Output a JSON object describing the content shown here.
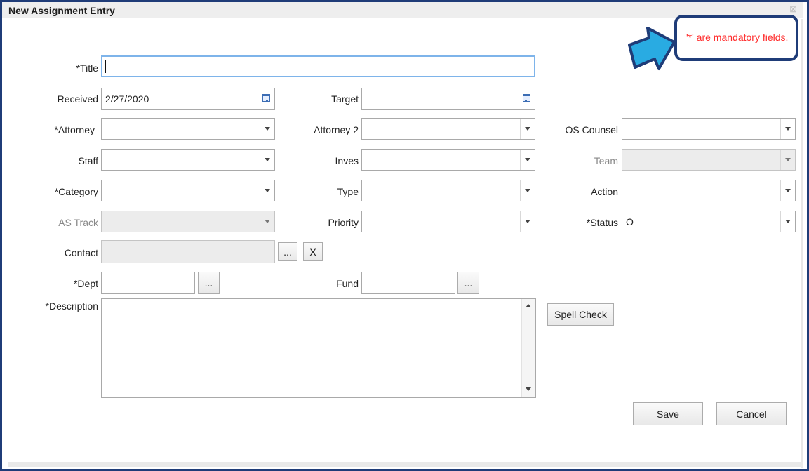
{
  "dialog": {
    "title": "New Assignment Entry",
    "close_glyph": "⊠"
  },
  "note": "'*' are mandatory fields.",
  "fields": {
    "title": {
      "label": "*Title",
      "value": ""
    },
    "received": {
      "label": "Received",
      "value": "2/27/2020"
    },
    "target": {
      "label": "Target",
      "value": ""
    },
    "attorney": {
      "label": "*Attorney",
      "value": ""
    },
    "attorney2": {
      "label": "Attorney 2",
      "value": ""
    },
    "os_counsel": {
      "label": "OS Counsel",
      "value": ""
    },
    "staff": {
      "label": "Staff",
      "value": ""
    },
    "inves": {
      "label": "Inves",
      "value": ""
    },
    "team": {
      "label": "Team",
      "value": ""
    },
    "category": {
      "label": "*Category",
      "value": ""
    },
    "type": {
      "label": "Type",
      "value": ""
    },
    "action": {
      "label": "Action",
      "value": ""
    },
    "as_track": {
      "label": "AS Track",
      "value": ""
    },
    "priority": {
      "label": "Priority",
      "value": ""
    },
    "status": {
      "label": "*Status",
      "value": "O"
    },
    "contact": {
      "label": "Contact",
      "value": "",
      "browse": "...",
      "clear": "X"
    },
    "dept": {
      "label": "*Dept",
      "value": "",
      "browse": "..."
    },
    "fund": {
      "label": "Fund",
      "value": "",
      "browse": "..."
    },
    "description": {
      "label": "*Description",
      "value": ""
    }
  },
  "buttons": {
    "spell_check": "Spell Check",
    "save": "Save",
    "cancel": "Cancel"
  },
  "colors": {
    "frame": "#1f3c78",
    "callout_text": "#ff2a2a",
    "arrow": "#29abe2"
  }
}
